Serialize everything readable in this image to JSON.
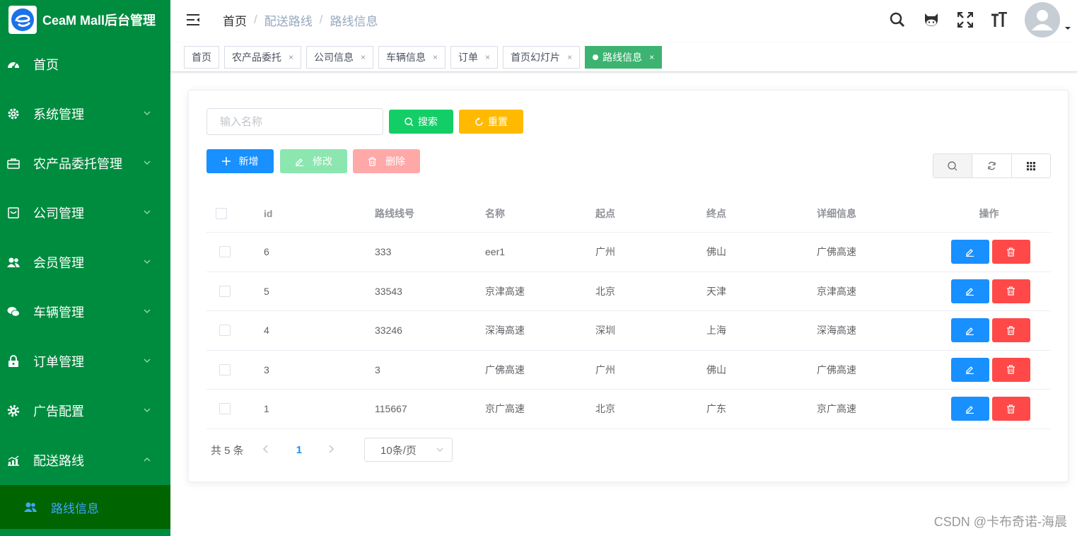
{
  "app": {
    "title": "CeaM Mall后台管理"
  },
  "sidebar": {
    "items": [
      {
        "label": "首页",
        "icon": "dashboard-icon",
        "expandable": false
      },
      {
        "label": "系统管理",
        "icon": "gear-icon",
        "expandable": true
      },
      {
        "label": "农产品委托管理",
        "icon": "briefcase-icon",
        "expandable": true
      },
      {
        "label": "公司管理",
        "icon": "tray-icon",
        "expandable": true
      },
      {
        "label": "会员管理",
        "icon": "users-icon",
        "expandable": true
      },
      {
        "label": "车辆管理",
        "icon": "wechat-icon",
        "expandable": true
      },
      {
        "label": "订单管理",
        "icon": "lock-icon",
        "expandable": true
      },
      {
        "label": "广告配置",
        "icon": "cog-icon",
        "expandable": true
      },
      {
        "label": "配送路线",
        "icon": "chart-icon",
        "expandable": true,
        "expanded": true
      }
    ],
    "subitem": {
      "label": "路线信息",
      "icon": "users-icon"
    },
    "colors": {
      "background": "#008c3f",
      "sub_background": "#006400",
      "active_text": "#3fa6ff"
    }
  },
  "header": {
    "breadcrumb": [
      "首页",
      "配送路线",
      "路线信息"
    ],
    "icons": [
      "search-icon",
      "github-icon",
      "fullscreen-icon",
      "font-size-icon"
    ]
  },
  "tags": [
    {
      "label": "首页",
      "closable": false,
      "active": false
    },
    {
      "label": "农产品委托",
      "closable": true,
      "active": false
    },
    {
      "label": "公司信息",
      "closable": true,
      "active": false
    },
    {
      "label": "车辆信息",
      "closable": true,
      "active": false
    },
    {
      "label": "订单",
      "closable": true,
      "active": false
    },
    {
      "label": "首页幻灯片",
      "closable": true,
      "active": false
    },
    {
      "label": "路线信息",
      "closable": true,
      "active": true
    }
  ],
  "toolbar": {
    "search_placeholder": "输入名称",
    "search_label": "搜索",
    "reset_label": "重置",
    "add_label": "新增",
    "edit_label": "修改",
    "delete_label": "删除"
  },
  "table": {
    "columns": [
      "id",
      "路线线号",
      "名称",
      "起点",
      "终点",
      "详细信息",
      "操作"
    ],
    "rows": [
      [
        "6",
        "333",
        "eer1",
        "广州",
        "佛山",
        "广佛高速"
      ],
      [
        "5",
        "33543",
        "京津高速",
        "北京",
        "天津",
        "京津高速"
      ],
      [
        "4",
        "33246",
        "深海高速",
        "深圳",
        "上海",
        "深海高速"
      ],
      [
        "3",
        "3",
        "广佛高速",
        "广州",
        "佛山",
        "广佛高速"
      ],
      [
        "1",
        "115667",
        "京广高速",
        "北京",
        "广东",
        "京广高速"
      ]
    ]
  },
  "pagination": {
    "total_text": "共 5 条",
    "current_page": "1",
    "page_size": "10条/页"
  },
  "watermark": "CSDN @卡布奇诺-海晨"
}
